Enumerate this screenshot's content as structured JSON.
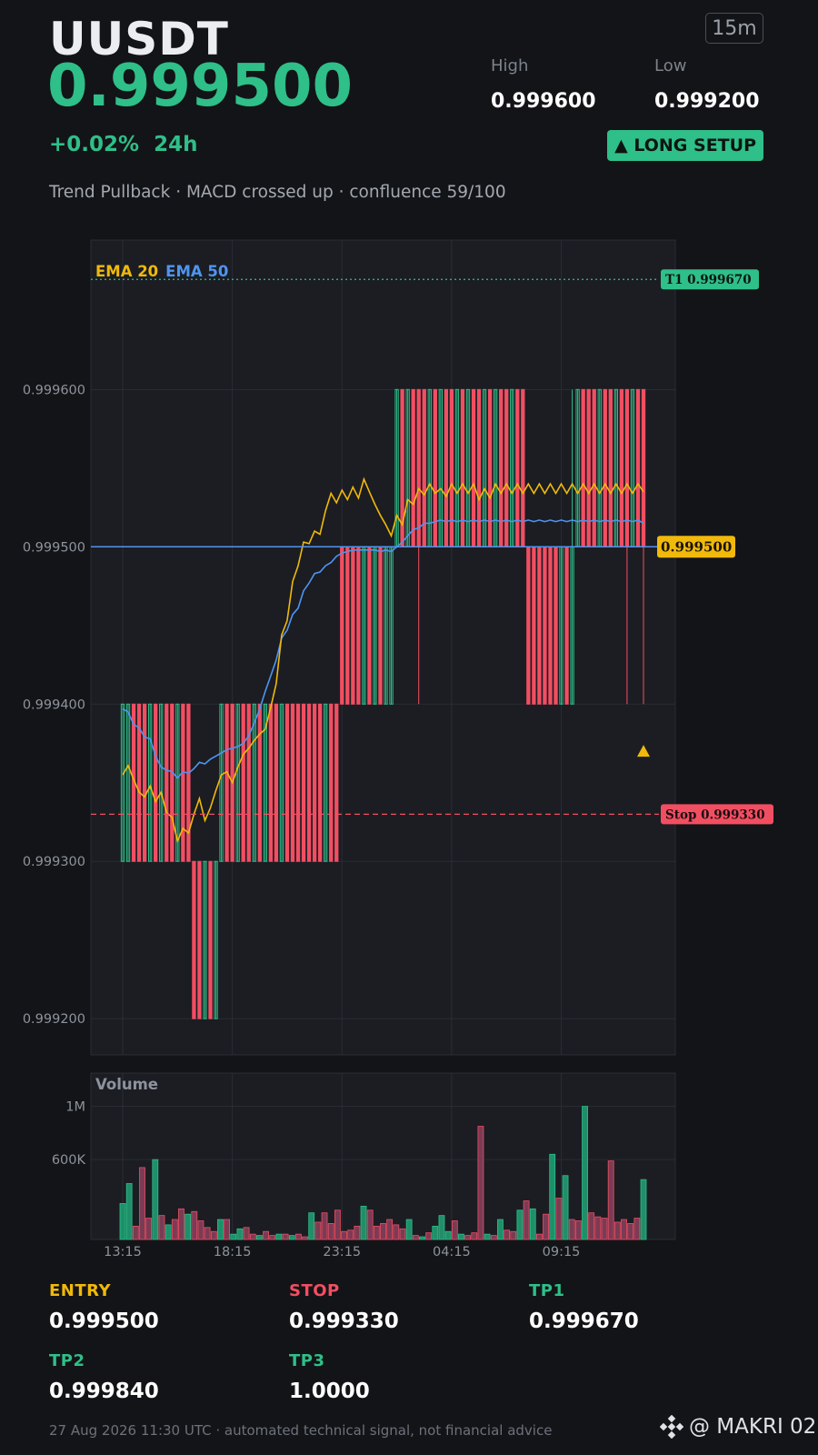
{
  "header": {
    "symbol": "UUSDT",
    "price": "0.999500",
    "change": "+0.02%",
    "period": "24h",
    "interval": "15m",
    "high_label": "High",
    "high_value": "0.999600",
    "low_label": "Low",
    "low_value": "0.999200",
    "setup_badge": "▲ LONG SETUP",
    "subtitle": "Trend Pullback · MACD crossed up · confluence 59/100"
  },
  "levels": {
    "entry": {
      "label": "ENTRY",
      "value": "0.999500"
    },
    "stop": {
      "label": "STOP",
      "value": "0.999330"
    },
    "tp1": {
      "label": "TP1",
      "value": "0.999670"
    },
    "tp2": {
      "label": "TP2",
      "value": "0.999840"
    },
    "tp3": {
      "label": "TP3",
      "value": "1.0000"
    }
  },
  "footer": {
    "disclaimer": "27 Aug 2026 11:30 UTC  ·  automated technical signal, not financial advice",
    "brand": "@ MAKRI 02"
  },
  "colors": {
    "up": "#2fbf89",
    "down": "#f24e62",
    "ema20": "#f0b90b",
    "ema50": "#4f95f0",
    "background": "#131417",
    "panel": "#1b1d23"
  },
  "chart_data": {
    "type": "candlestick",
    "price_ticks": [
      0.9996,
      0.9995,
      0.9994,
      0.9993,
      0.9992
    ],
    "price_tick_labels": [
      "0.999600",
      "0.999500",
      "0.999400",
      "0.999300",
      "0.999200"
    ],
    "ylim": [
      0.999177,
      0.999695
    ],
    "x_tick_labels": [
      "13:15",
      "18:15",
      "23:15",
      "04:15",
      "09:15"
    ],
    "legend": [
      "EMA 20",
      "EMA 50"
    ],
    "current_price_label": "0.999500",
    "tp1_line": {
      "label": "T1 0.999670",
      "value": 0.99967
    },
    "stop_line": {
      "label": "Stop 0.999330",
      "value": 0.99933
    },
    "candles": [
      {
        "o": 0.9993,
        "h": 0.9994,
        "l": 0.9993,
        "c": 0.9994
      },
      {
        "o": 0.9993,
        "h": 0.9994,
        "l": 0.9993,
        "c": 0.9994
      },
      {
        "o": 0.9994,
        "h": 0.9994,
        "l": 0.9993,
        "c": 0.9993
      },
      {
        "o": 0.9994,
        "h": 0.9994,
        "l": 0.9993,
        "c": 0.9993
      },
      {
        "o": 0.9994,
        "h": 0.9994,
        "l": 0.9993,
        "c": 0.9993
      },
      {
        "o": 0.9993,
        "h": 0.9994,
        "l": 0.9993,
        "c": 0.9994
      },
      {
        "o": 0.9994,
        "h": 0.9994,
        "l": 0.9993,
        "c": 0.9993
      },
      {
        "o": 0.9993,
        "h": 0.9994,
        "l": 0.9993,
        "c": 0.9994
      },
      {
        "o": 0.9994,
        "h": 0.9994,
        "l": 0.9993,
        "c": 0.9993
      },
      {
        "o": 0.9994,
        "h": 0.9994,
        "l": 0.9993,
        "c": 0.9993
      },
      {
        "o": 0.9993,
        "h": 0.9994,
        "l": 0.9993,
        "c": 0.9994
      },
      {
        "o": 0.9994,
        "h": 0.9994,
        "l": 0.9993,
        "c": 0.9993
      },
      {
        "o": 0.9994,
        "h": 0.9994,
        "l": 0.9993,
        "c": 0.9993
      },
      {
        "o": 0.9993,
        "h": 0.9993,
        "l": 0.9992,
        "c": 0.9992
      },
      {
        "o": 0.9993,
        "h": 0.9993,
        "l": 0.9992,
        "c": 0.9992
      },
      {
        "o": 0.9992,
        "h": 0.9993,
        "l": 0.9992,
        "c": 0.9993
      },
      {
        "o": 0.9993,
        "h": 0.9993,
        "l": 0.9992,
        "c": 0.9992
      },
      {
        "o": 0.9992,
        "h": 0.9993,
        "l": 0.9992,
        "c": 0.9993
      },
      {
        "o": 0.9993,
        "h": 0.9994,
        "l": 0.9993,
        "c": 0.9994
      },
      {
        "o": 0.9994,
        "h": 0.9994,
        "l": 0.9993,
        "c": 0.9993
      },
      {
        "o": 0.9994,
        "h": 0.9994,
        "l": 0.9993,
        "c": 0.9993
      },
      {
        "o": 0.9993,
        "h": 0.9994,
        "l": 0.9993,
        "c": 0.9994
      },
      {
        "o": 0.9994,
        "h": 0.9994,
        "l": 0.9993,
        "c": 0.9993
      },
      {
        "o": 0.9994,
        "h": 0.9994,
        "l": 0.9993,
        "c": 0.9993
      },
      {
        "o": 0.9993,
        "h": 0.9994,
        "l": 0.9993,
        "c": 0.9994
      },
      {
        "o": 0.9994,
        "h": 0.9994,
        "l": 0.9993,
        "c": 0.9993
      },
      {
        "o": 0.9993,
        "h": 0.9994,
        "l": 0.9993,
        "c": 0.9994
      },
      {
        "o": 0.9994,
        "h": 0.9994,
        "l": 0.9993,
        "c": 0.9993
      },
      {
        "o": 0.9994,
        "h": 0.9994,
        "l": 0.9993,
        "c": 0.9993
      },
      {
        "o": 0.9993,
        "h": 0.9994,
        "l": 0.9993,
        "c": 0.9994
      },
      {
        "o": 0.9994,
        "h": 0.9994,
        "l": 0.9993,
        "c": 0.9993
      },
      {
        "o": 0.9994,
        "h": 0.9994,
        "l": 0.9993,
        "c": 0.9993
      },
      {
        "o": 0.9994,
        "h": 0.9994,
        "l": 0.9993,
        "c": 0.9993
      },
      {
        "o": 0.9994,
        "h": 0.9994,
        "l": 0.9993,
        "c": 0.9993
      },
      {
        "o": 0.9994,
        "h": 0.9994,
        "l": 0.9993,
        "c": 0.9993
      },
      {
        "o": 0.9994,
        "h": 0.9994,
        "l": 0.9993,
        "c": 0.9993
      },
      {
        "o": 0.9994,
        "h": 0.9994,
        "l": 0.9993,
        "c": 0.9993
      },
      {
        "o": 0.9993,
        "h": 0.9994,
        "l": 0.9993,
        "c": 0.9994
      },
      {
        "o": 0.9994,
        "h": 0.9994,
        "l": 0.9993,
        "c": 0.9993
      },
      {
        "o": 0.9994,
        "h": 0.9994,
        "l": 0.9993,
        "c": 0.9993
      },
      {
        "o": 0.9995,
        "h": 0.9995,
        "l": 0.9994,
        "c": 0.9994
      },
      {
        "o": 0.9995,
        "h": 0.9995,
        "l": 0.9994,
        "c": 0.9994
      },
      {
        "o": 0.9995,
        "h": 0.9995,
        "l": 0.9994,
        "c": 0.9994
      },
      {
        "o": 0.9995,
        "h": 0.9995,
        "l": 0.9994,
        "c": 0.9994
      },
      {
        "o": 0.9994,
        "h": 0.9995,
        "l": 0.9994,
        "c": 0.9995
      },
      {
        "o": 0.9995,
        "h": 0.9995,
        "l": 0.9994,
        "c": 0.9994
      },
      {
        "o": 0.9994,
        "h": 0.9995,
        "l": 0.9994,
        "c": 0.9995
      },
      {
        "o": 0.9995,
        "h": 0.9995,
        "l": 0.9994,
        "c": 0.9994
      },
      {
        "o": 0.9994,
        "h": 0.9995,
        "l": 0.9994,
        "c": 0.9995
      },
      {
        "o": 0.9994,
        "h": 0.9995,
        "l": 0.9994,
        "c": 0.9995
      },
      {
        "o": 0.9995,
        "h": 0.9996,
        "l": 0.9995,
        "c": 0.9996
      },
      {
        "o": 0.9996,
        "h": 0.9996,
        "l": 0.9995,
        "c": 0.9995
      },
      {
        "o": 0.9995,
        "h": 0.9996,
        "l": 0.9995,
        "c": 0.9996
      },
      {
        "o": 0.9996,
        "h": 0.9996,
        "l": 0.9995,
        "c": 0.9995
      },
      {
        "o": 0.9996,
        "h": 0.9996,
        "l": 0.9994,
        "c": 0.9995
      },
      {
        "o": 0.9996,
        "h": 0.9996,
        "l": 0.9995,
        "c": 0.9995
      },
      {
        "o": 0.9995,
        "h": 0.9996,
        "l": 0.9995,
        "c": 0.9996
      },
      {
        "o": 0.9996,
        "h": 0.9996,
        "l": 0.9995,
        "c": 0.9995
      },
      {
        "o": 0.9995,
        "h": 0.9996,
        "l": 0.9995,
        "c": 0.9996
      },
      {
        "o": 0.9996,
        "h": 0.9996,
        "l": 0.9995,
        "c": 0.9995
      },
      {
        "o": 0.9996,
        "h": 0.9996,
        "l": 0.9995,
        "c": 0.9995
      },
      {
        "o": 0.9995,
        "h": 0.9996,
        "l": 0.9995,
        "c": 0.9996
      },
      {
        "o": 0.9996,
        "h": 0.9996,
        "l": 0.9995,
        "c": 0.9995
      },
      {
        "o": 0.9995,
        "h": 0.9996,
        "l": 0.9995,
        "c": 0.9996
      },
      {
        "o": 0.9996,
        "h": 0.9996,
        "l": 0.9995,
        "c": 0.9995
      },
      {
        "o": 0.9996,
        "h": 0.9996,
        "l": 0.9995,
        "c": 0.9995
      },
      {
        "o": 0.9995,
        "h": 0.9996,
        "l": 0.9995,
        "c": 0.9996
      },
      {
        "o": 0.9996,
        "h": 0.9996,
        "l": 0.9995,
        "c": 0.9995
      },
      {
        "o": 0.9995,
        "h": 0.9996,
        "l": 0.9995,
        "c": 0.9996
      },
      {
        "o": 0.9996,
        "h": 0.9996,
        "l": 0.9995,
        "c": 0.9995
      },
      {
        "o": 0.9996,
        "h": 0.9996,
        "l": 0.9995,
        "c": 0.9995
      },
      {
        "o": 0.9995,
        "h": 0.9996,
        "l": 0.9995,
        "c": 0.9996
      },
      {
        "o": 0.9996,
        "h": 0.9996,
        "l": 0.9995,
        "c": 0.9995
      },
      {
        "o": 0.9996,
        "h": 0.9996,
        "l": 0.9995,
        "c": 0.9995
      },
      {
        "o": 0.9995,
        "h": 0.9995,
        "l": 0.9994,
        "c": 0.9994
      },
      {
        "o": 0.9995,
        "h": 0.9995,
        "l": 0.9994,
        "c": 0.9994
      },
      {
        "o": 0.9995,
        "h": 0.9995,
        "l": 0.9994,
        "c": 0.9994
      },
      {
        "o": 0.9995,
        "h": 0.9995,
        "l": 0.9994,
        "c": 0.9994
      },
      {
        "o": 0.9995,
        "h": 0.9995,
        "l": 0.9994,
        "c": 0.9994
      },
      {
        "o": 0.9995,
        "h": 0.9995,
        "l": 0.9994,
        "c": 0.9994
      },
      {
        "o": 0.9994,
        "h": 0.9995,
        "l": 0.9994,
        "c": 0.9995
      },
      {
        "o": 0.9995,
        "h": 0.9995,
        "l": 0.9994,
        "c": 0.9994
      },
      {
        "o": 0.9994,
        "h": 0.9996,
        "l": 0.9994,
        "c": 0.9995
      },
      {
        "o": 0.9995,
        "h": 0.9996,
        "l": 0.9995,
        "c": 0.9996
      },
      {
        "o": 0.9996,
        "h": 0.9996,
        "l": 0.9995,
        "c": 0.9995
      },
      {
        "o": 0.9996,
        "h": 0.9996,
        "l": 0.9995,
        "c": 0.9995
      },
      {
        "o": 0.9996,
        "h": 0.9996,
        "l": 0.9995,
        "c": 0.9995
      },
      {
        "o": 0.9995,
        "h": 0.9996,
        "l": 0.9995,
        "c": 0.9996
      },
      {
        "o": 0.9996,
        "h": 0.9996,
        "l": 0.9995,
        "c": 0.9995
      },
      {
        "o": 0.9996,
        "h": 0.9996,
        "l": 0.9995,
        "c": 0.9995
      },
      {
        "o": 0.9995,
        "h": 0.9996,
        "l": 0.9995,
        "c": 0.9996
      },
      {
        "o": 0.9996,
        "h": 0.9996,
        "l": 0.9995,
        "c": 0.9995
      },
      {
        "o": 0.9996,
        "h": 0.9996,
        "l": 0.9994,
        "c": 0.9995
      },
      {
        "o": 0.9995,
        "h": 0.9996,
        "l": 0.9995,
        "c": 0.9996
      },
      {
        "o": 0.9996,
        "h": 0.9996,
        "l": 0.9995,
        "c": 0.9995
      },
      {
        "o": 0.9996,
        "h": 0.9996,
        "l": 0.9994,
        "c": 0.9995
      }
    ],
    "ema20": [
      0.999355,
      0.999361,
      0.999352,
      0.999344,
      0.999341,
      0.999348,
      0.999338,
      0.999344,
      0.999331,
      0.999328,
      0.999313,
      0.999321,
      0.999318,
      0.99933,
      0.99934,
      0.999326,
      0.999334,
      0.999345,
      0.999355,
      0.999357,
      0.99935,
      0.99936,
      0.999368,
      0.999372,
      0.999377,
      0.999381,
      0.999384,
      0.999398,
      0.999413,
      0.999444,
      0.999453,
      0.999478,
      0.999488,
      0.999503,
      0.999502,
      0.99951,
      0.999508,
      0.999523,
      0.999534,
      0.999528,
      0.999536,
      0.99953,
      0.999538,
      0.999531,
      0.999543,
      0.999535,
      0.999527,
      0.99952,
      0.999514,
      0.999507,
      0.99952,
      0.999514,
      0.99953,
      0.999527,
      0.999537,
      0.999533,
      0.99954,
      0.999534,
      0.999537,
      0.999532,
      0.99954,
      0.999534,
      0.99954,
      0.999534,
      0.99954,
      0.99953,
      0.999537,
      0.999531,
      0.99954,
      0.999534,
      0.99954,
      0.999534,
      0.99954,
      0.999534,
      0.99954,
      0.999534,
      0.99954,
      0.999534,
      0.99954,
      0.999534,
      0.99954,
      0.999534,
      0.99954,
      0.999534,
      0.99954,
      0.999534,
      0.99954,
      0.999534,
      0.99954,
      0.999534,
      0.99954,
      0.999534,
      0.99954,
      0.999534,
      0.99954,
      0.999535
    ],
    "ema50": [
      0.999397,
      0.999395,
      0.999387,
      0.999385,
      0.999379,
      0.999378,
      0.999367,
      0.99936,
      0.999358,
      0.999357,
      0.999353,
      0.999357,
      0.999356,
      0.999359,
      0.999363,
      0.999362,
      0.999365,
      0.999367,
      0.999369,
      0.999371,
      0.999372,
      0.999373,
      0.999375,
      0.99938,
      0.999388,
      0.999397,
      0.999408,
      0.999418,
      0.999428,
      0.999442,
      0.999447,
      0.999457,
      0.999461,
      0.999472,
      0.999477,
      0.999483,
      0.999484,
      0.999488,
      0.99949,
      0.999494,
      0.999496,
      0.999497,
      0.999498,
      0.999498,
      0.999498,
      0.999498,
      0.999498,
      0.999497,
      0.999498,
      0.999497,
      0.9995,
      0.999503,
      0.999507,
      0.999511,
      0.999512,
      0.999515,
      0.999515,
      0.999516,
      0.999517,
      0.999516,
      0.999517,
      0.999516,
      0.999517,
      0.999516,
      0.999517,
      0.999516,
      0.999517,
      0.999516,
      0.999517,
      0.999516,
      0.999517,
      0.999516,
      0.999517,
      0.999516,
      0.999517,
      0.999516,
      0.999517,
      0.999516,
      0.999517,
      0.999516,
      0.999517,
      0.999516,
      0.999517,
      0.999516,
      0.999517,
      0.999516,
      0.999517,
      0.999516,
      0.999517,
      0.999516,
      0.999517,
      0.999516,
      0.999517,
      0.999516,
      0.999517,
      0.999515
    ],
    "volume": {
      "label": "Volume",
      "tick_labels": [
        "1M",
        "600K"
      ],
      "ticks": [
        1000000,
        600000
      ],
      "ylim": [
        0,
        1250000
      ],
      "values": [
        270000,
        420000,
        100000,
        540000,
        160000,
        600000,
        180000,
        110000,
        150000,
        230000,
        190000,
        210000,
        140000,
        90000,
        60000,
        150000,
        150000,
        40000,
        80000,
        90000,
        40000,
        30000,
        60000,
        30000,
        40000,
        40000,
        30000,
        40000,
        20000,
        200000,
        130000,
        200000,
        120000,
        220000,
        60000,
        70000,
        100000,
        250000,
        220000,
        100000,
        120000,
        150000,
        110000,
        80000,
        150000,
        30000,
        20000,
        50000,
        100000,
        180000,
        60000,
        140000,
        40000,
        30000,
        50000,
        850000,
        40000,
        30000,
        150000,
        70000,
        60000,
        220000,
        290000,
        230000,
        40000,
        190000,
        640000,
        310000,
        480000,
        150000,
        140000,
        1000000,
        200000,
        170000,
        160000,
        590000,
        130000,
        150000,
        120000,
        160000,
        450000
      ]
    }
  }
}
